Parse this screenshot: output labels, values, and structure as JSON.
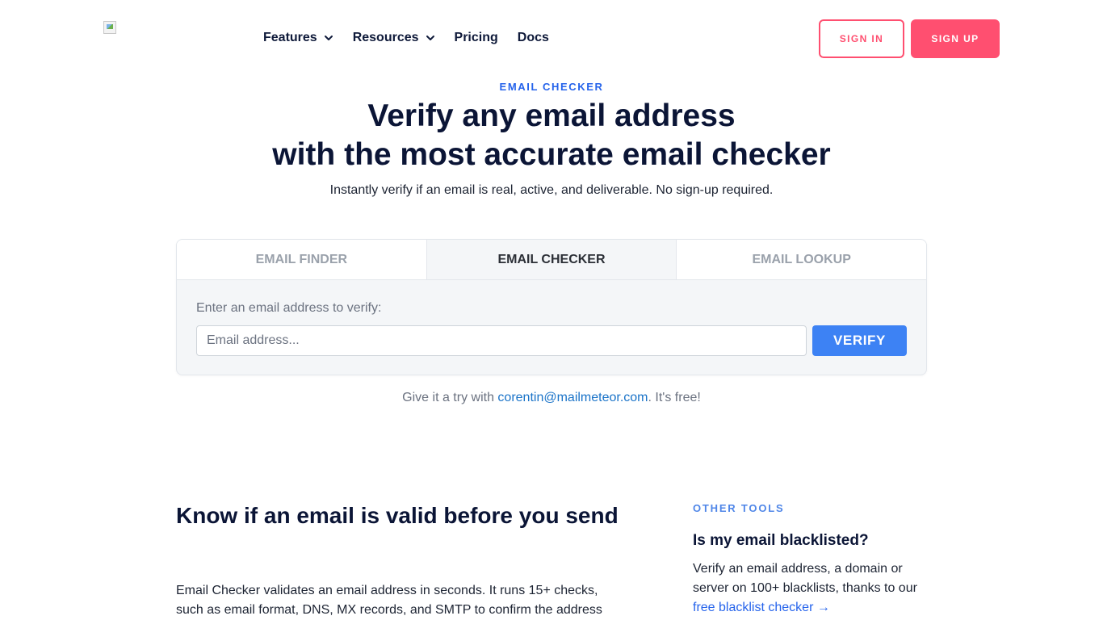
{
  "header": {
    "logo_alt": "",
    "nav": [
      {
        "label": "Features",
        "has_dropdown": true
      },
      {
        "label": "Resources",
        "has_dropdown": true
      },
      {
        "label": "Pricing",
        "has_dropdown": false
      },
      {
        "label": "Docs",
        "has_dropdown": false
      }
    ],
    "signin_label": "SIGN IN",
    "signup_label": "SIGN UP"
  },
  "hero": {
    "eyebrow": "EMAIL CHECKER",
    "title_line1": "Verify any email address",
    "title_line2": "with the most accurate email checker",
    "subtitle": "Instantly verify if an email is real, active, and deliverable. No sign-up required."
  },
  "tool": {
    "tabs": [
      {
        "label": "EMAIL FINDER",
        "active": false
      },
      {
        "label": "EMAIL CHECKER",
        "active": true
      },
      {
        "label": "EMAIL LOOKUP",
        "active": false
      }
    ],
    "field_label": "Enter an email address to verify:",
    "input_placeholder": "Email address...",
    "input_value": "",
    "verify_label": "VERIFY"
  },
  "try_line": {
    "prefix": "Give it a try with ",
    "email_link": "corentin@mailmeteor.com",
    "suffix": ". It's free!"
  },
  "main": {
    "heading": "Know if an email is valid before you send",
    "body": "Email Checker validates an email address in seconds. It runs 15+ checks, such as email format, DNS, MX records, and SMTP to confirm the address"
  },
  "sidebar": {
    "eyebrow": "OTHER TOOLS",
    "title": "Is my email blacklisted?",
    "body": "Verify an email address, a domain or server on 100+ blacklists, thanks to our ",
    "link": "free blacklist checker →"
  },
  "colors": {
    "brand_pink": "#ff4f70",
    "primary_blue": "#3d82f4",
    "link_blue": "#1a73c8",
    "heading_navy": "#0b1536"
  },
  "icons": [
    "broken-image-icon",
    "chevron-down-icon"
  ]
}
